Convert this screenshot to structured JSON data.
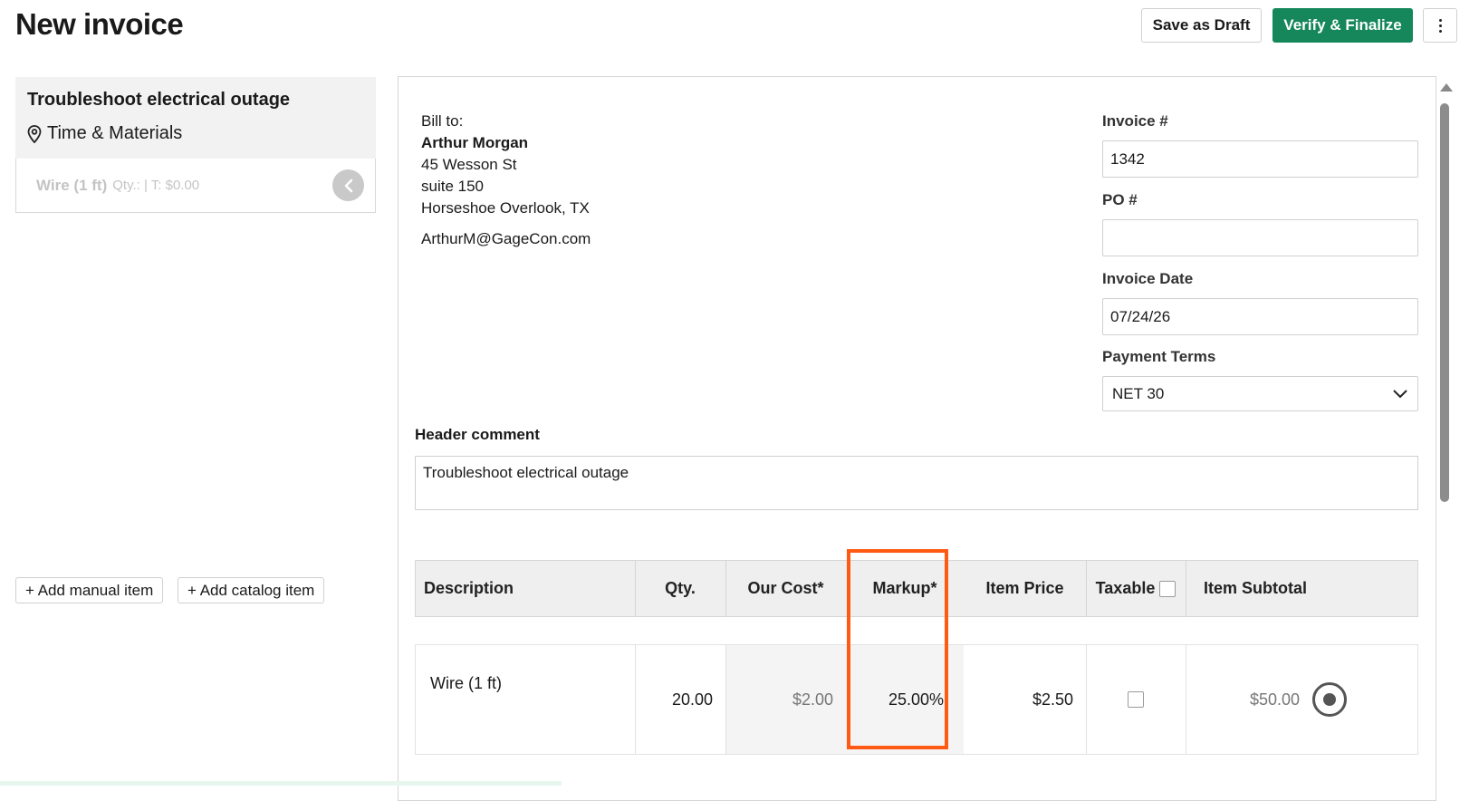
{
  "page": {
    "title": "New invoice"
  },
  "toolbar": {
    "save_draft": "Save as Draft",
    "verify_finalize": "Verify & Finalize",
    "more_icon": "vertical-dots-icon"
  },
  "job": {
    "title": "Troubleshoot electrical outage",
    "type": "Time & Materials",
    "type_icon": "location-pin-icon",
    "item": {
      "name": "Wire (1 ft)",
      "meta": "Qty.: | T: $0.00"
    }
  },
  "actions": {
    "add_manual": "+ Add manual item",
    "add_catalog": "+ Add catalog item"
  },
  "bill_to": {
    "label": "Bill to:",
    "name": "Arthur Morgan",
    "street": "45 Wesson St",
    "suite": "suite 150",
    "city": "Horseshoe Overlook, TX",
    "email": "ArthurM@GageCon.com"
  },
  "fields": {
    "invoice_no": {
      "label": "Invoice #",
      "value": "1342"
    },
    "po_no": {
      "label": "PO #",
      "value": ""
    },
    "invoice_date": {
      "label": "Invoice Date",
      "value": "07/24/26"
    },
    "payment_terms": {
      "label": "Payment Terms",
      "value": "NET 30"
    }
  },
  "header_comment": {
    "label": "Header comment",
    "value": "Troubleshoot electrical outage"
  },
  "table": {
    "columns": {
      "description": "Description",
      "qty": "Qty.",
      "our_cost": "Our Cost*",
      "markup": "Markup*",
      "item_price": "Item Price",
      "taxable": "Taxable",
      "item_subtotal": "Item Subtotal"
    },
    "rows": [
      {
        "description": "Wire (1 ft)",
        "qty": "20.00",
        "our_cost": "$2.00",
        "markup": "25.00%",
        "item_price": "$2.50",
        "taxable": false,
        "item_subtotal": "$50.00"
      }
    ]
  },
  "colors": {
    "primary": "#15875a",
    "highlight": "#ff5a14"
  }
}
